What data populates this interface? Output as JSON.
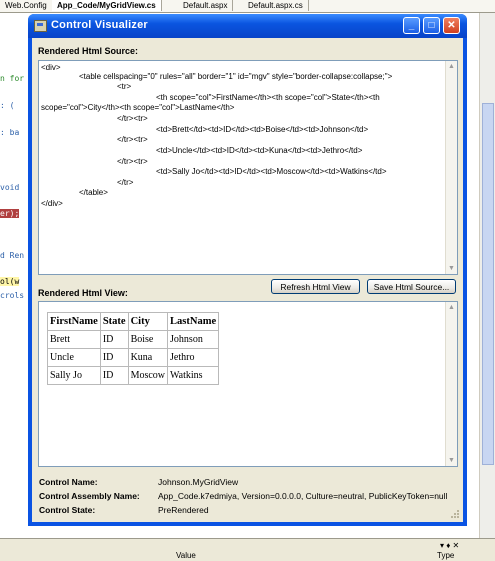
{
  "ide": {
    "tabs": [
      "Web.Config",
      "App_Code/MyGridView.cs",
      "Default.aspx",
      "Default.aspx.cs"
    ],
    "active_tab": 1,
    "code_fragments": [
      "n for",
      ": (",
      ": ba",
      "void",
      "er);",
      "d Ren",
      "ol(w",
      "crols"
    ],
    "bottom_value_header": "Value",
    "bottom_type_header": "Type"
  },
  "dialog": {
    "title": "Control Visualizer",
    "source_label": "Rendered Html Source:",
    "source_lines": [
      "<div>",
      "<table cellspacing=\"0\" rules=\"all\" border=\"1\" id=\"mgv\" style=\"border-collapse:collapse;\">",
      "<tr>",
      "<th scope=\"col\">FirstName</th><th scope=\"col\">State</th><th",
      "scope=\"col\">City</th><th scope=\"col\">LastName</th>",
      "</tr><tr>",
      "<td>Brett</td><td>ID</td><td>Boise</td><td>Johnson</td>",
      "</tr><tr>",
      "<td>Uncle</td><td>ID</td><td>Kuna</td><td>Jethro</td>",
      "</tr><tr>",
      "<td>Sally Jo</td><td>ID</td><td>Moscow</td><td>Watkins</td>",
      "</tr>",
      "</table>",
      "</div>"
    ],
    "refresh_button": "Refresh Html View",
    "save_button": "Save Html Source...",
    "view_label": "Rendered Html View:",
    "grid": {
      "headers": [
        "FirstName",
        "State",
        "City",
        "LastName"
      ],
      "rows": [
        [
          "Brett",
          "ID",
          "Boise",
          "Johnson"
        ],
        [
          "Uncle",
          "ID",
          "Kuna",
          "Jethro"
        ],
        [
          "Sally Jo",
          "ID",
          "Moscow",
          "Watkins"
        ]
      ]
    },
    "info": {
      "control_name_label": "Control Name:",
      "control_name_value": "Johnson.MyGridView",
      "assembly_label": "Control Assembly Name:",
      "assembly_value": "App_Code.k7edmiya, Version=0.0.0.0, Culture=neutral, PublicKeyToken=null",
      "state_label": "Control State:",
      "state_value": "PreRendered"
    }
  }
}
